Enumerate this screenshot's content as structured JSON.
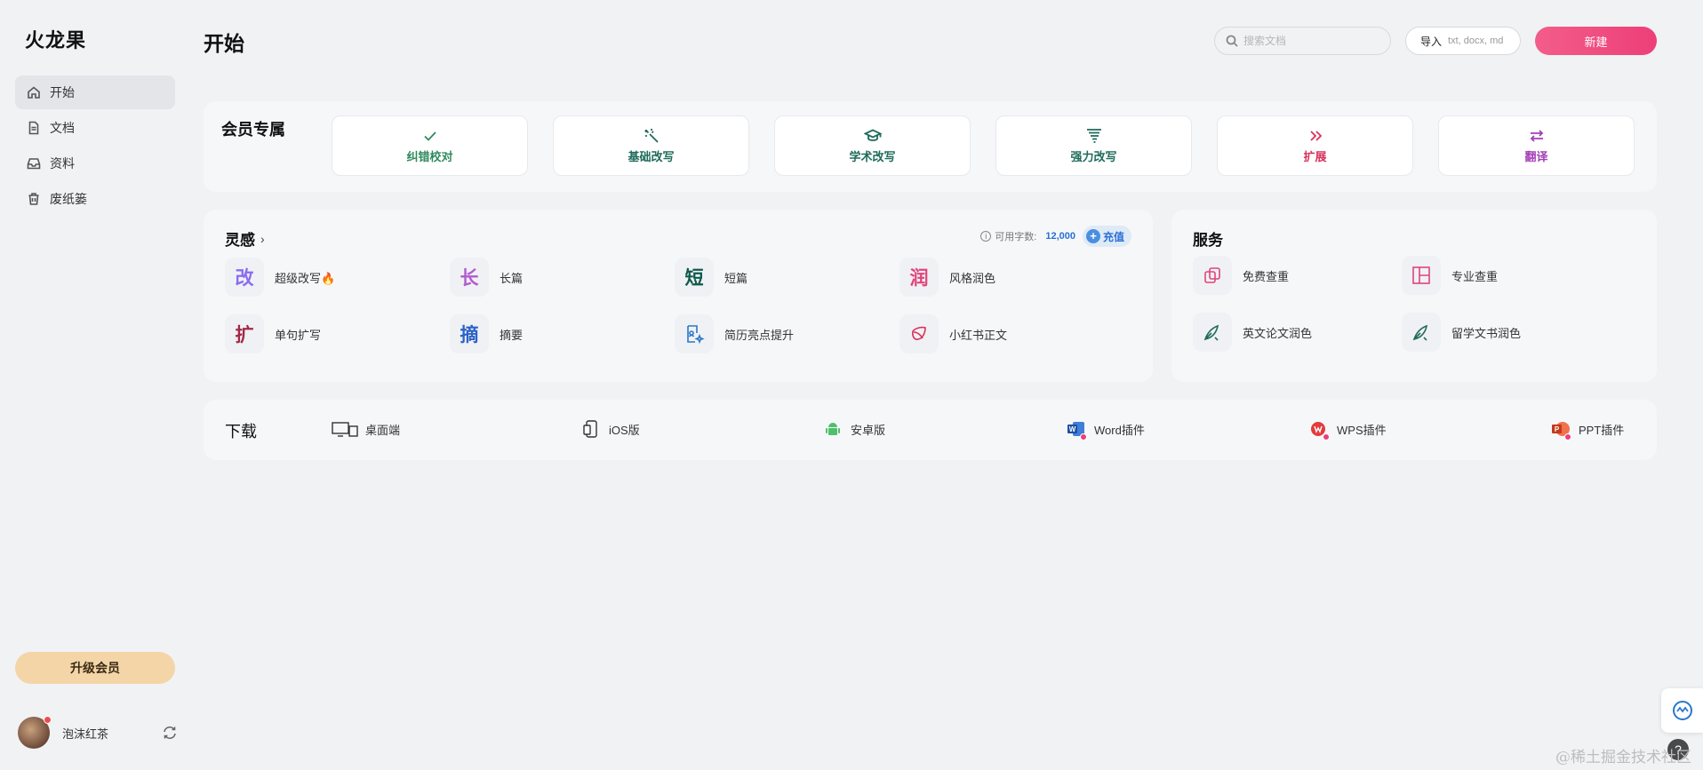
{
  "app": {
    "logo": "火龙果"
  },
  "sidebar": {
    "items": [
      {
        "label": "开始",
        "icon": "home-icon",
        "active": true
      },
      {
        "label": "文档",
        "icon": "document-icon"
      },
      {
        "label": "资料",
        "icon": "inbox-icon"
      },
      {
        "label": "废纸篓",
        "icon": "trash-icon"
      }
    ],
    "upgrade_label": "升级会员",
    "user": {
      "name": "泡沫红茶"
    }
  },
  "header": {
    "title": "开始",
    "search_placeholder": "搜索文档",
    "import_label": "导入",
    "import_types": "txt, docx, md",
    "new_label": "新建"
  },
  "member": {
    "title": "会员专属",
    "cards": [
      {
        "label": "纠错校对",
        "icon": "check-icon",
        "color": "#2f8a5d"
      },
      {
        "label": "基础改写",
        "icon": "magic-wand-icon",
        "color": "#1f6b5b"
      },
      {
        "label": "学术改写",
        "icon": "graduation-cap-icon",
        "color": "#1f6b5b"
      },
      {
        "label": "强力改写",
        "icon": "tornado-icon",
        "color": "#1f6b5b"
      },
      {
        "label": "扩展",
        "icon": "double-chevron-right-icon",
        "color": "#d8325b"
      },
      {
        "label": "翻译",
        "icon": "swap-icon",
        "color": "#a23fb8"
      }
    ]
  },
  "inspiration": {
    "title": "灵感",
    "quota_label": "可用字数:",
    "quota_value": "12,000",
    "recharge_label": "充值",
    "tools": [
      {
        "glyph": "改",
        "label": "超级改写🔥",
        "color": "#8a6cf0"
      },
      {
        "glyph": "长",
        "label": "长篇",
        "color": "#b25bd0"
      },
      {
        "glyph": "短",
        "label": "短篇",
        "color": "#0e5a4c"
      },
      {
        "glyph": "润",
        "label": "风格润色",
        "color": "#e0457a"
      },
      {
        "glyph": "扩",
        "label": "单句扩写",
        "color": "#a3284a"
      },
      {
        "glyph": "摘",
        "label": "摘要",
        "color": "#2c63c8"
      },
      {
        "glyph": "",
        "label": "简历亮点提升",
        "icon": "resume-icon",
        "color": "#2a77c9"
      },
      {
        "glyph": "",
        "label": "小红书正文",
        "icon": "leaf-icon",
        "color": "#d8325b"
      }
    ]
  },
  "service": {
    "title": "服务",
    "items": [
      {
        "label": "免费查重",
        "icon": "copy-check-icon",
        "color": "#e0457a"
      },
      {
        "label": "专业查重",
        "icon": "layout-icon",
        "color": "#e0457a"
      },
      {
        "label": "英文论文润色",
        "icon": "pen-icon",
        "color": "#1f6b5b"
      },
      {
        "label": "留学文书润色",
        "icon": "pen-icon",
        "color": "#1f6b5b"
      }
    ]
  },
  "download": {
    "title": "下载",
    "items": [
      {
        "label": "桌面端",
        "icon": "desktop-icon"
      },
      {
        "label": "iOS版",
        "icon": "ios-icon"
      },
      {
        "label": "安卓版",
        "icon": "android-icon"
      },
      {
        "label": "Word插件",
        "icon": "word-icon"
      },
      {
        "label": "WPS插件",
        "icon": "wps-icon"
      },
      {
        "label": "PPT插件",
        "icon": "ppt-icon"
      }
    ]
  },
  "watermark": "@稀土掘金技术社区"
}
